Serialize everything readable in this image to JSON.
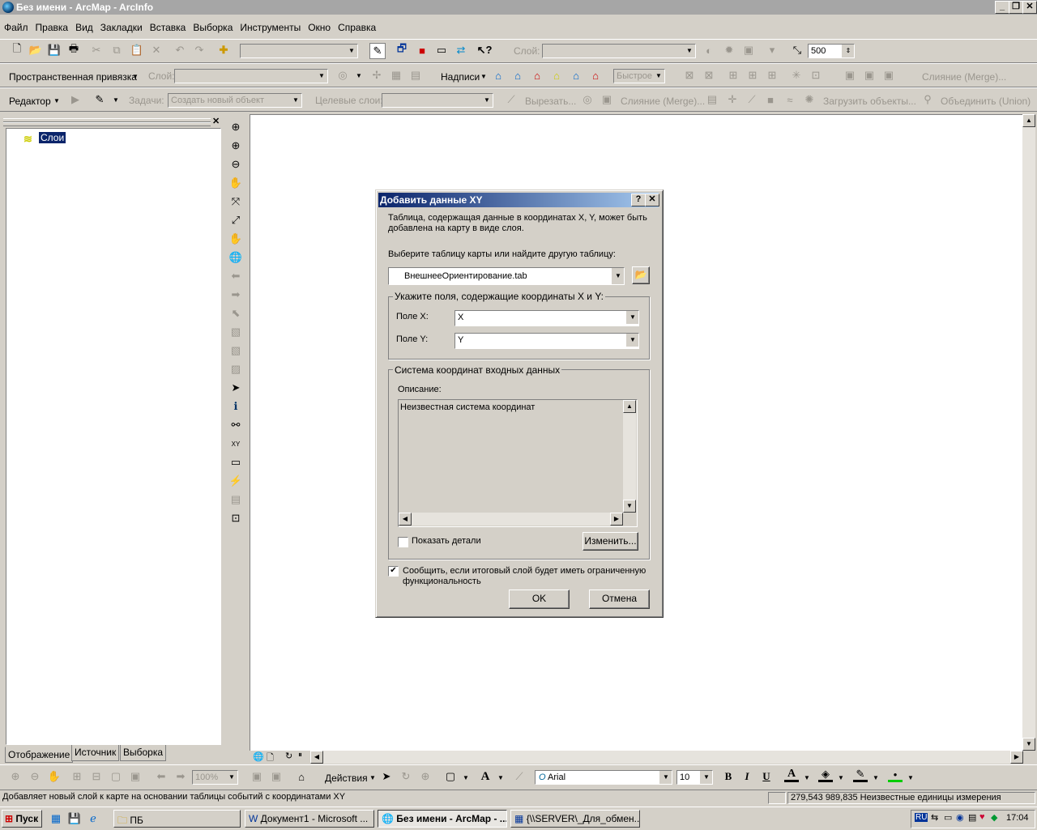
{
  "window": {
    "title": "Без имени - ArcMap - ArcInfo"
  },
  "menu": [
    "Файл",
    "Правка",
    "Вид",
    "Закладки",
    "Вставка",
    "Выборка",
    "Инструменты",
    "Окно",
    "Справка"
  ],
  "toolbar1": {
    "layer_label": "Слой:",
    "scale_value": "500"
  },
  "toolbar2": {
    "snapping_label": "Пространственная привязка",
    "layer_label": "Слой:",
    "labels_label": "Надписи",
    "fast_value": "Быстрое",
    "merge_label": "Слияние (Merge)..."
  },
  "toolbar3": {
    "editor_label": "Редактор",
    "task_label": "Задачи:",
    "task_value": "Создать новый объект",
    "target_label": "Целевые слои:",
    "cut_label": "Вырезать...",
    "merge_label": "Слияние (Merge)...",
    "load_label": "Загрузить объекты...",
    "union_label": "Объединить (Union)"
  },
  "toc": {
    "layers_label": "Слои",
    "tabs": [
      "Отображение",
      "Источник",
      "Выборка"
    ]
  },
  "dialog": {
    "title": "Добавить данные XY",
    "intro": "Таблица, содержащая данные в координатах X, Y, может быть добавлена на карту в виде слоя.",
    "choose_table_label": "Выберите таблицу карты или найдите другую таблицу:",
    "table_value": "ВнешнееОриентирование.tab",
    "fields_group": "Укажите поля, содержащие координаты X и Y:",
    "field_x_label": "Поле X:",
    "field_x_value": "X",
    "field_y_label": "Поле Y:",
    "field_y_value": "Y",
    "crs_group": "Система координат входных данных",
    "description_label": "Описание:",
    "description_value": "Неизвестная система координат",
    "show_details_label": "Показать детали",
    "show_details_checked": false,
    "change_button": "Изменить...",
    "warn_label": "Сообщить, если итоговый слой будет иметь ограниченную функциональность",
    "warn_checked": true,
    "ok_button": "OK",
    "cancel_button": "Отмена"
  },
  "drawing_toolbar": {
    "zoom_value": "100%",
    "actions_label": "Действия",
    "font_value": "Arial",
    "size_value": "10",
    "bold": "B",
    "italic": "I",
    "underline": "U"
  },
  "status": {
    "message": "Добавляет новый слой к карте на основании таблицы событий с координатами XY",
    "coords": "279,543  989,835 Неизвестные единицы измерения"
  },
  "taskbar": {
    "start_label": "Пуск",
    "items": [
      "ПБ",
      "Документ1 - Microsoft ...",
      "Без имени - ArcMap - ...",
      "{\\\\SERVER\\_Для_обмен..."
    ],
    "lang": "RU",
    "time": "17:04"
  },
  "colors": {
    "title_active": "#0a246a",
    "title_inactive": "#a6a6a6",
    "face": "#d4d0c8"
  }
}
